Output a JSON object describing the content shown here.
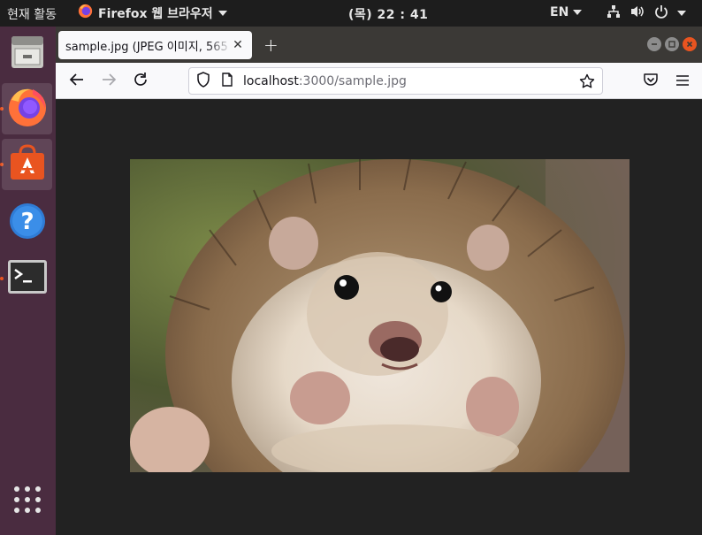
{
  "topbar": {
    "activities": "현재 활동",
    "app_menu": "Firefox 웹 브라우저",
    "clock": "(목) 22 : 41",
    "language": "EN"
  },
  "dock": {
    "items": [
      "files",
      "firefox",
      "software",
      "help",
      "terminal",
      "show-apps"
    ]
  },
  "browser": {
    "tab_title": "sample.jpg (JPEG 이미지, 565",
    "url_host": "localhost",
    "url_path": ":3000/sample.jpg"
  },
  "colors": {
    "accent": "#e95420",
    "dock_bg": "#4a2c40",
    "topbar_bg": "#1d1d1d",
    "viewer_bg": "#222222"
  }
}
